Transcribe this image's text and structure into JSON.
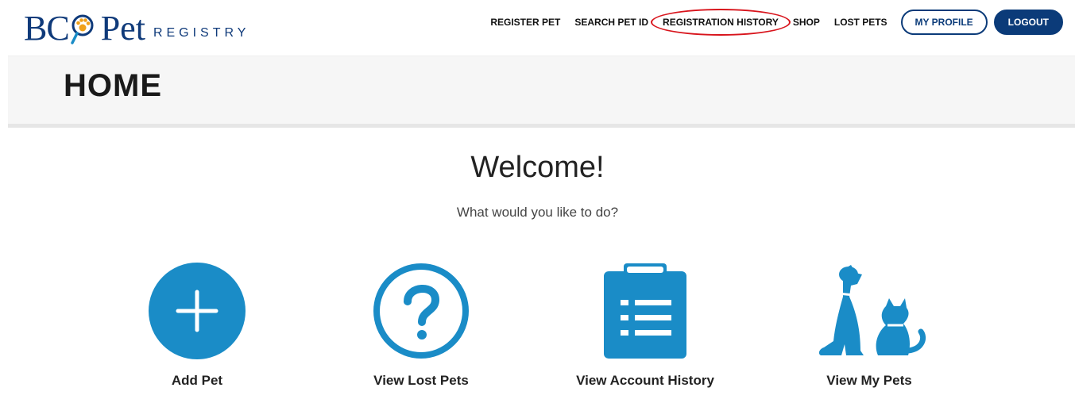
{
  "header": {
    "logo": {
      "text_bc": "BC",
      "text_pet": "Pet",
      "text_registry": "REGISTRY"
    },
    "nav": {
      "register_pet": "REGISTER PET",
      "search_pet_id": "SEARCH PET ID",
      "registration_history": "REGISTRATION HISTORY",
      "shop": "SHOP",
      "lost_pets": "LOST PETS",
      "my_profile": "MY PROFILE",
      "logout": "LOGOUT"
    },
    "colors": {
      "brand_navy": "#0b3b79",
      "highlight_red": "#d8141c"
    }
  },
  "banner": {
    "title": "HOME"
  },
  "main": {
    "welcome": "Welcome!",
    "subtitle": "What would you like to do?",
    "actions": [
      {
        "label": "Add Pet",
        "icon": "plus-circle-icon"
      },
      {
        "label": "View Lost Pets",
        "icon": "question-circle-icon"
      },
      {
        "label": "View Account History",
        "icon": "clipboard-list-icon"
      },
      {
        "label": "View My Pets",
        "icon": "dog-cat-icon"
      }
    ],
    "icon_color": "#1a8cc7"
  }
}
